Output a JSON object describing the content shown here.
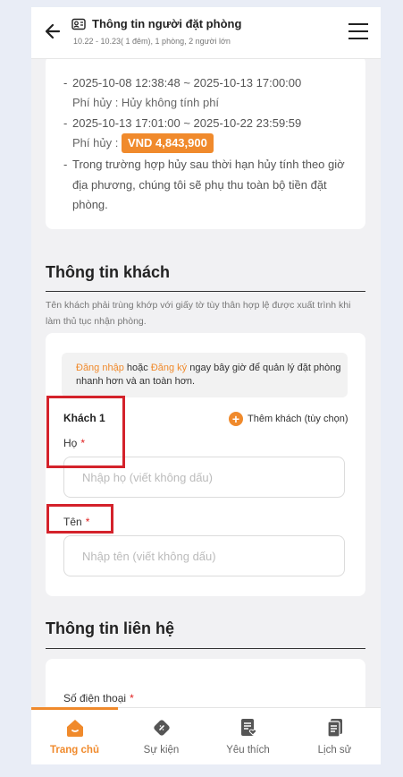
{
  "header": {
    "title": "Thông tin người đặt phòng",
    "subtitle": "10.22 - 10.23( 1 đêm), 1 phòng, 2 người lớn"
  },
  "policy": {
    "items": [
      {
        "range": "2025-10-08 12:38:48 ~ 2025-10-13 17:00:00",
        "fee_label": "Phí hủy : Hủy không tính phí"
      },
      {
        "range": "2025-10-13 17:01:00 ~ 2025-10-22 23:59:59",
        "fee_label": "Phí hủy :",
        "fee_value": "VND 4,843,900"
      },
      {
        "range": "Trong trường hợp hủy sau thời hạn hủy tính theo giờ địa phương, chúng tôi sẽ phụ thu toàn bộ tiền đặt phòng."
      }
    ]
  },
  "guest_section": {
    "title": "Thông tin khách",
    "note": "Tên khách phải trùng khớp với giấy tờ tùy thân hợp lệ được xuất trình khi làm thủ tục nhận phòng.",
    "login_link": "Đăng nhập",
    "or_text": "hoặc",
    "register_link": "Đăng ký",
    "login_suffix": "ngay bây giờ để quản lý đặt phòng nhanh hơn và an toàn hơn.",
    "guest_label": "Khách 1",
    "add_guest": "Thêm khách (tùy chọn)",
    "last_name_label": "Họ",
    "last_name_placeholder": "Nhập họ (viết không dấu)",
    "first_name_label": "Tên",
    "first_name_placeholder": "Nhập tên (viết không dấu)",
    "required_mark": "*"
  },
  "contact_section": {
    "title": "Thông tin liên hệ",
    "phone_label": "Số điện thoại",
    "required_mark": "*"
  },
  "bottom_nav": [
    {
      "label": "Trang chủ",
      "icon": "home-icon",
      "active": true
    },
    {
      "label": "Sự kiện",
      "icon": "event-icon",
      "active": false
    },
    {
      "label": "Yêu thích",
      "icon": "favorite-icon",
      "active": false
    },
    {
      "label": "Lịch sử",
      "icon": "history-icon",
      "active": false
    }
  ],
  "colors": {
    "accent": "#f08a2c",
    "highlight": "#d4222b",
    "required": "#e02020"
  }
}
